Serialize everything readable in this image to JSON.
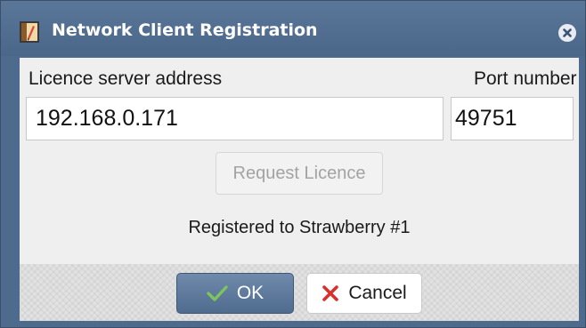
{
  "window": {
    "title": "Network Client Registration"
  },
  "form": {
    "server_label": "Licence server address",
    "server_value": "192.168.0.171",
    "port_label": "Port number",
    "port_value": "49751",
    "request_button_label": "Request Licence",
    "status_text": "Registered to Strawberry #1"
  },
  "footer": {
    "ok_label": "OK",
    "cancel_label": "Cancel"
  },
  "icons": {
    "app": "app-icon",
    "close": "close-icon",
    "ok": "checkmark-icon",
    "cancel": "cross-icon"
  },
  "colors": {
    "titlebar": "#4e6a8c",
    "ok_check": "#7cc55b",
    "cancel_cross": "#d9302b"
  }
}
